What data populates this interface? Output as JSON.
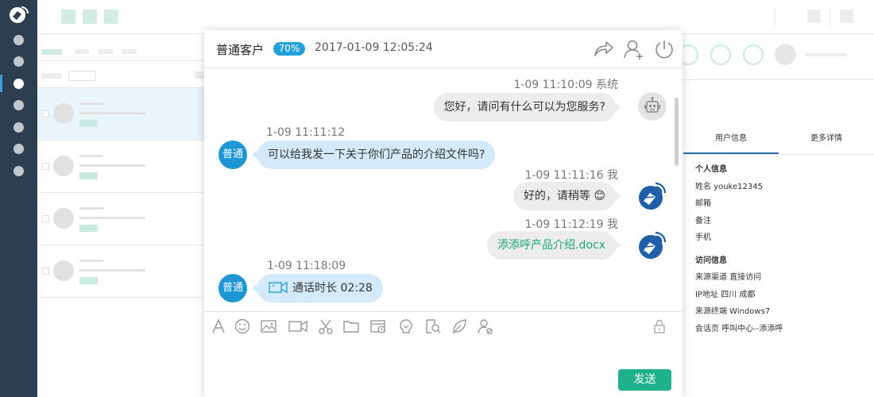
{
  "colors": {
    "sidebar_bg": "#2d3e50",
    "accent_blue": "#24a0db",
    "customer_bubble": "#d4e9fb",
    "agent_bubble": "#ececec",
    "file_link": "#1aa579",
    "send_button": "#1fb28a"
  },
  "sidebar": {
    "logo_icon": "app-logo-icon",
    "nav_icons": [
      "nav-icon-1",
      "nav-icon-2",
      "nav-icon-3",
      "nav-icon-4",
      "nav-icon-5",
      "nav-icon-6",
      "nav-icon-7"
    ],
    "active_index": 2
  },
  "chat": {
    "header": {
      "customer_label": "普通客户",
      "badge": "70%",
      "datetime": "2017-01-09  12:05:24",
      "icons": [
        "transfer-icon",
        "add-user-icon",
        "power-icon"
      ]
    },
    "messages": [
      {
        "side": "right",
        "meta": "1-09  11:10:09  系统",
        "text": "您好，请问有什么可以为您服务?",
        "avatar": "robot-avatar-icon"
      },
      {
        "side": "left",
        "meta": "1-09  11:11:12",
        "text": "可以给我发一下关于你们产品的介绍文件吗?",
        "avatar_label": "普通"
      },
      {
        "side": "right",
        "meta": "1-09  11:11:16  我",
        "text": "好的，请稍等 ",
        "emoji": "😊",
        "avatar": "agent-logo-avatar"
      },
      {
        "side": "right",
        "meta": "1-09  11:12:19  我",
        "text": "添添呼产品介绍.docx",
        "avatar": "agent-logo-avatar"
      },
      {
        "side": "left",
        "meta": "1-09  11:18:09",
        "text": "通话时长  02:28",
        "icon": "video-call-icon",
        "avatar_label": "普通"
      }
    ],
    "toolbar_icons": [
      "font-icon",
      "emoji-icon",
      "image-icon",
      "video-icon",
      "screenshot-icon",
      "folder-icon",
      "history-icon",
      "knowledge-icon",
      "search-doc-icon",
      "leaf-icon",
      "user-settings-icon",
      "lock-icon"
    ],
    "send_label": "发送"
  },
  "info_panel": {
    "tabs": [
      "用户信息",
      "更多详情"
    ],
    "active_tab": 0,
    "personal_title": "个人信息",
    "personal": [
      "姓名 youke12345",
      "邮箱",
      "备注",
      "手机"
    ],
    "visit_title": "访问信息",
    "visit": [
      "来源渠道 直接访问",
      "IP地址 四川 成都",
      "来源终端 Windows7",
      "会话页 呼叫中心--添添呼"
    ]
  }
}
